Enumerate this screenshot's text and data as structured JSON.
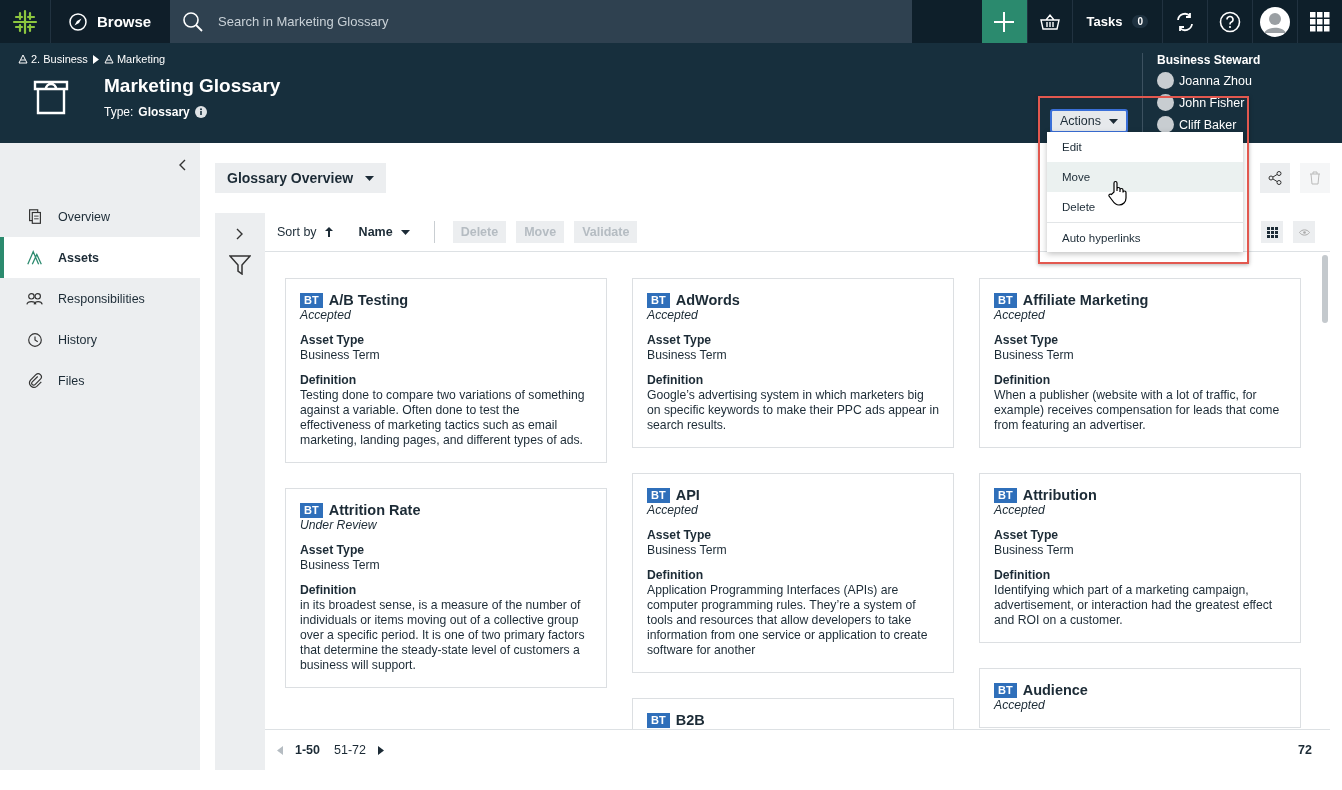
{
  "top_bar": {
    "browse": "Browse",
    "search": {
      "placeholder": "Search in Marketing Glossary"
    },
    "tasks": {
      "label": "Tasks",
      "count": "0"
    }
  },
  "header": {
    "breadcrumb": [
      "2. Business",
      "Marketing"
    ],
    "title": "Marketing Glossary",
    "type_label": "Type:",
    "type_value": "Glossary",
    "actions_button": "Actions"
  },
  "stewards": {
    "title": "Business Steward",
    "people": [
      "Joanna Zhou",
      "John Fisher",
      "Cliff Baker"
    ]
  },
  "actions_menu": {
    "items": [
      {
        "label": "Edit",
        "hovered": false
      },
      {
        "label": "Move",
        "hovered": true
      },
      {
        "label": "Delete",
        "hovered": false
      },
      {
        "label": "Auto hyperlinks",
        "hovered": false
      }
    ]
  },
  "sidebar": {
    "items": [
      {
        "label": "Overview",
        "selected": false
      },
      {
        "label": "Assets",
        "selected": true
      },
      {
        "label": "Responsibilities",
        "selected": false
      },
      {
        "label": "History",
        "selected": false
      },
      {
        "label": "Files",
        "selected": false
      }
    ]
  },
  "view_selector": "Glossary Overview",
  "toolbar": {
    "sort_label": "Sort by",
    "sort_field": "Name",
    "buttons": [
      {
        "label": "Delete",
        "disabled": true
      },
      {
        "label": "Move",
        "disabled": true
      },
      {
        "label": "Validate",
        "disabled": true
      }
    ]
  },
  "columns": [
    [
      {
        "badge": "BT",
        "title": "A/B Testing",
        "status": "Accepted",
        "fields": [
          {
            "label": "Asset Type",
            "value": "Business Term"
          },
          {
            "label": "Definition",
            "value": "Testing done to compare two variations of something against a variable. Often done to test the effectiveness of marketing tactics such as email marketing, landing pages, and different types of ads."
          }
        ]
      },
      {
        "badge": "BT",
        "title": "Attrition Rate",
        "status": "Under Review",
        "fields": [
          {
            "label": "Asset Type",
            "value": "Business Term"
          },
          {
            "label": "Definition",
            "value": "in its broadest sense, is a measure of the number of individuals or items moving out of a collective group over a specific period. It is one of two primary factors that determine the steady-state level of customers a business will support."
          }
        ]
      }
    ],
    [
      {
        "badge": "BT",
        "title": "AdWords",
        "status": "Accepted",
        "fields": [
          {
            "label": "Asset Type",
            "value": "Business Term"
          },
          {
            "label": "Definition",
            "value": "Google’s advertising system in which marketers big on specific keywords to make their PPC ads appear in search results."
          }
        ]
      },
      {
        "badge": "BT",
        "title": "API",
        "status": "Accepted",
        "fields": [
          {
            "label": "Asset Type",
            "value": "Business Term"
          },
          {
            "label": "Definition",
            "value": "Application Programming Interfaces (APIs) are computer programming rules. They’re a system of tools and resources that allow developers to take information from one service or application to create software for another"
          }
        ]
      },
      {
        "badge": "BT",
        "title": "B2B"
      }
    ],
    [
      {
        "badge": "BT",
        "title": "Affiliate Marketing",
        "status": "Accepted",
        "fields": [
          {
            "label": "Asset Type",
            "value": "Business Term"
          },
          {
            "label": "Definition",
            "value": "When a publisher (website with a lot of traffic, for example) receives compensation for leads that come from featuring an advertiser."
          }
        ]
      },
      {
        "badge": "BT",
        "title": "Attribution",
        "status": "Accepted",
        "fields": [
          {
            "label": "Asset Type",
            "value": "Business Term"
          },
          {
            "label": "Definition",
            "value": "Identifying which part of a marketing campaign, advertisement, or interaction had the greatest effect and ROI on a customer."
          }
        ]
      },
      {
        "badge": "BT",
        "title": "Audience",
        "status": "Accepted"
      }
    ]
  ],
  "pagination": {
    "pages": [
      {
        "label": "1-50",
        "selected": true
      },
      {
        "label": "51-72",
        "selected": false
      }
    ],
    "total": "72"
  }
}
